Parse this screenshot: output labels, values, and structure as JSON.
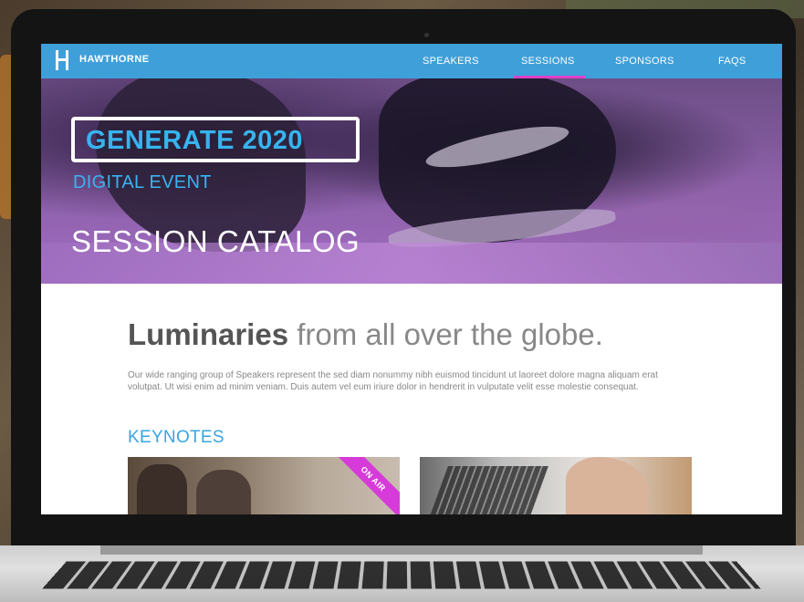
{
  "nav": {
    "brand": "HAWTHORNE",
    "items": [
      {
        "label": "SPEAKERS"
      },
      {
        "label": "SESSIONS",
        "active": true
      },
      {
        "label": "SPONSORS"
      },
      {
        "label": "FAQS"
      }
    ]
  },
  "hero": {
    "event_name": "GENERATE 2020",
    "event_type": "DIGITAL EVENT",
    "page_heading": "SESSION CATALOG"
  },
  "content": {
    "headline_bold": "Luminaries",
    "headline_rest": " from all over the globe.",
    "intro": "Our wide ranging group of Speakers represent the sed diam nonummy nibh euismod tincidunt ut laoreet dolore magna aliquam erat volutpat. Ut wisi enim ad minim veniam. Duis autem vel eum iriure dolor in hendrerit in vulputate velit esse molestie consequat.",
    "section_title": "KEYNOTES",
    "cards": [
      {
        "badge": "ON AIR"
      },
      {}
    ]
  },
  "colors": {
    "nav_bg": "#3f9fd9",
    "accent_blue": "#37b4ef",
    "active_underline": "#e040c8",
    "badge": "#d63ad8"
  },
  "icons": [
    "hawthorne-logo-icon"
  ]
}
